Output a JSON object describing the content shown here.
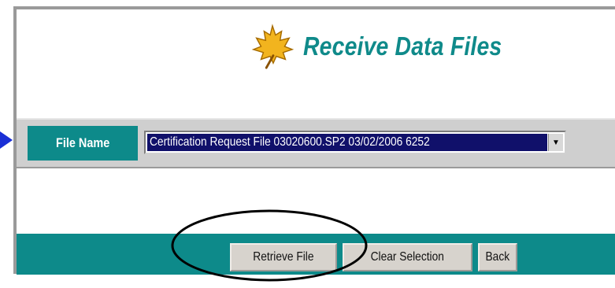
{
  "page": {
    "title": "Receive Data Files"
  },
  "file_selector": {
    "label": "File Name",
    "selected_value": "Certification Request File 03020600.SP2 03/02/2006 6252"
  },
  "buttons": {
    "retrieve": "Retrieve File",
    "clear": "Clear Selection",
    "back": "Back"
  },
  "colors": {
    "accent_teal": "#0d8a8a",
    "selection_navy": "#10106a",
    "arrow_blue": "#1a2fd6"
  }
}
